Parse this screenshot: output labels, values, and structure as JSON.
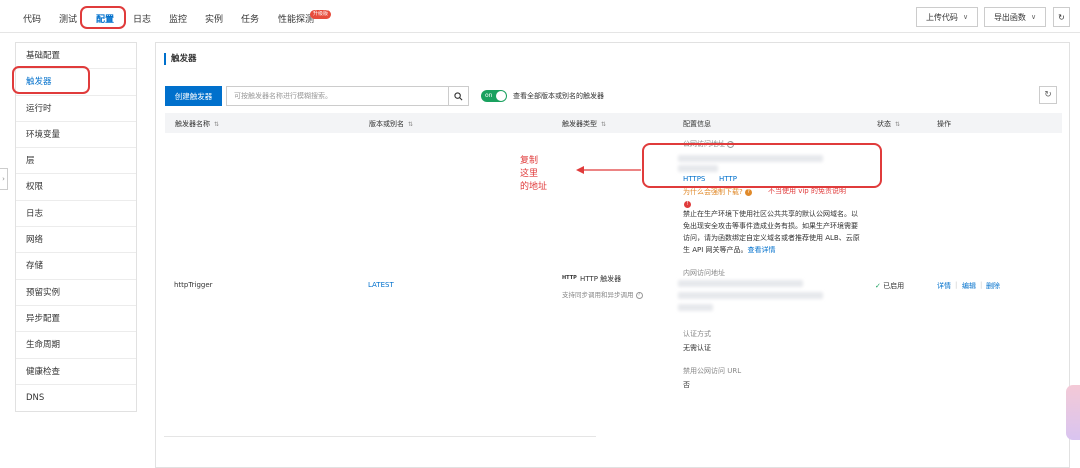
{
  "top_tabs": [
    "代码",
    "测试",
    "配置",
    "日志",
    "监控",
    "实例",
    "任务",
    "性能探测"
  ],
  "tab_badge": "升级版",
  "top_buttons": {
    "upload": "上传代码",
    "export": "导出函数"
  },
  "sidebar": [
    "基础配置",
    "触发器",
    "运行时",
    "环境变量",
    "层",
    "权限",
    "日志",
    "网络",
    "存储",
    "预留实例",
    "异步配置",
    "生命周期",
    "健康检查",
    "DNS"
  ],
  "panel": {
    "title": "触发器",
    "create_button": "创建触发器",
    "search_placeholder": "可按触发器名称进行模糊搜索。",
    "toggle_on_label": "on",
    "toggle_label": "查看全部版本或别名的触发器"
  },
  "table": {
    "headers": [
      "触发器名称",
      "版本或别名",
      "触发器类型",
      "配置信息",
      "状态",
      "操作"
    ],
    "row": {
      "name": "httpTrigger",
      "version": "LATEST",
      "type_icon": "HTTP",
      "type": "HTTP 触发器",
      "type_sub": "支持同步调用和异步调用",
      "public_addr_label": "公网访问地址",
      "protocols": [
        "HTTPS",
        "HTTP"
      ],
      "why_download": "为什么会强制下载?",
      "annot_note": "不当使用 vip 的免责说明",
      "warning_text": "禁止在生产环境下使用社区公共共享的默认公网域名。以免出现安全攻击等事件造成业务有损。如果生产环境需要访问，请为函数绑定自定义域名或者推荐使用 ALB、云原生 API 网关等产品。",
      "warning_link": "查看详情",
      "internal_addr_label": "内网访问地址",
      "auth_label": "认证方式",
      "auth_value": "无需认证",
      "disable_public_label": "禁用公网访问 URL",
      "disable_public_value": "否",
      "status": "已启用",
      "actions": [
        "详情",
        "编辑",
        "删除"
      ]
    }
  },
  "annotation": {
    "lines": [
      "复制",
      "这里",
      "的地址"
    ],
    "color": "#e03b3b"
  },
  "colors": {
    "accent": "#0070cc",
    "success": "#1aa15f",
    "annotation": "#e03b3b"
  }
}
